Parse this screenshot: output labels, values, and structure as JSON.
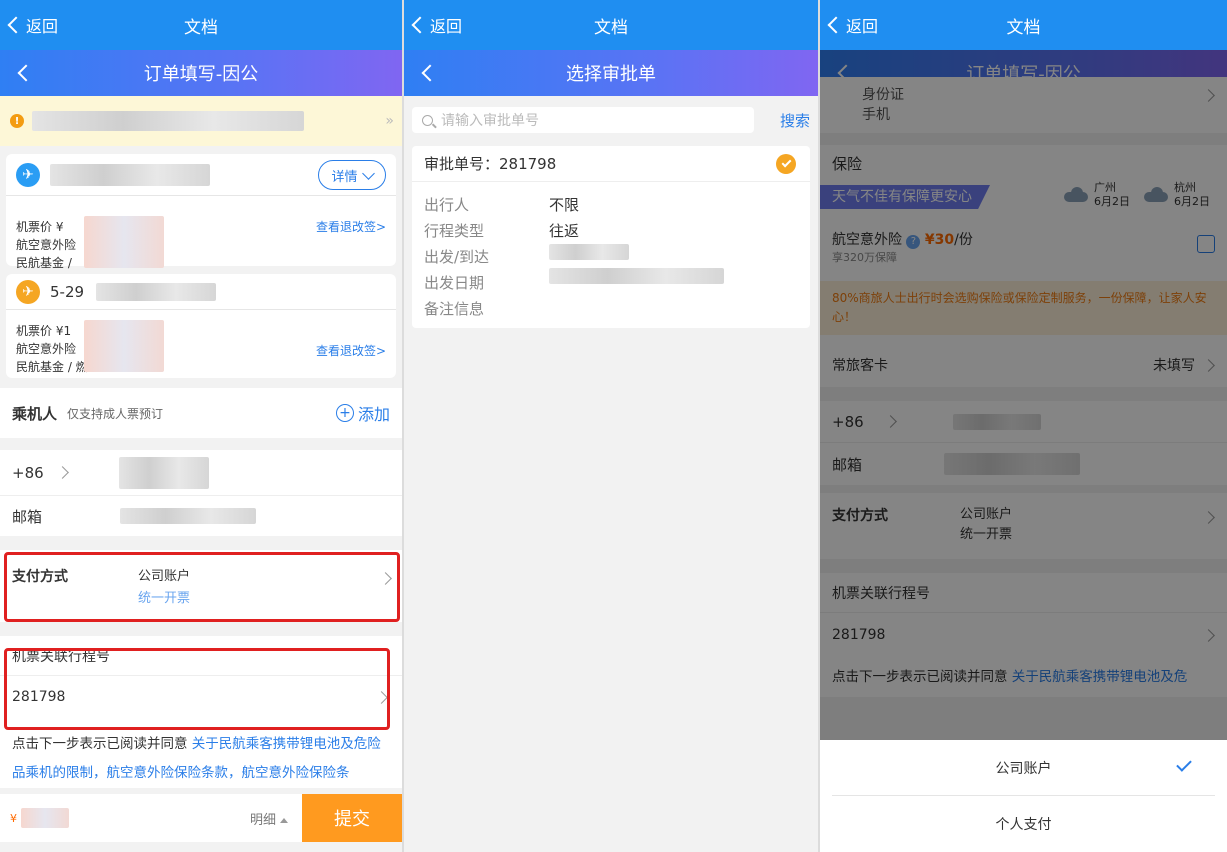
{
  "system": {
    "back_label": "返回",
    "title": "文档"
  },
  "panel1": {
    "nav_title": "订单填写-因公",
    "flight1": {
      "detail_label": "详情",
      "fee_labels": [
        "机票价 ¥",
        "航空意外险",
        "民航基金 /"
      ],
      "change_link": "查看退改签>"
    },
    "flight2": {
      "date": "5-29",
      "fee_labels": [
        "机票价 ¥1",
        "航空意外险",
        "民航基金 / 燃"
      ],
      "change_link": "查看退改签>"
    },
    "passenger": {
      "title": "乘机人",
      "note": "仅支持成人票预订",
      "add_label": "添加"
    },
    "phone_code": "+86",
    "email_label": "邮箱",
    "payment": {
      "label": "支付方式",
      "value": "公司账户",
      "sub": "统一开票"
    },
    "itinerary": {
      "label": "机票关联行程号",
      "value": "281798"
    },
    "agreement": {
      "prefix": "点击下一步表示已阅读并同意 ",
      "link": "关于民航乘客携带锂电池及危险品乘机的限制，航空意外险保险条款，航空意外险保险条"
    },
    "bottom": {
      "currency": "¥",
      "detail_label": "明细",
      "submit_label": "提交"
    }
  },
  "panel2": {
    "nav_title": "选择审批单",
    "search_placeholder": "请输入审批单号",
    "search_button": "搜索",
    "approval": {
      "number_label": "审批单号：281798",
      "rows": [
        {
          "key": "出行人",
          "value": "不限"
        },
        {
          "key": "行程类型",
          "value": "往返"
        },
        {
          "key": "出发/到达",
          "value": ""
        },
        {
          "key": "出发日期",
          "value": ""
        },
        {
          "key": "备注信息",
          "value": ""
        }
      ]
    }
  },
  "panel3": {
    "nav_title": "订单填写-因公",
    "top_partial": {
      "line1": "身份证",
      "line2": "手机"
    },
    "insurance": {
      "title": "保险",
      "banner": "天气不佳有保障更安心",
      "weather": [
        {
          "city": "广州",
          "date": "6月2日"
        },
        {
          "city": "杭州",
          "date": "6月2日"
        }
      ],
      "product": "航空意外险",
      "price": "¥30",
      "unit": "/份",
      "coverage": "享320万保障",
      "tip": "80%商旅人士出行时会选购保险或保险定制服务，一份保障，让家人安心！"
    },
    "frequent_flyer": {
      "label": "常旅客卡",
      "value": "未填写"
    },
    "phone_code": "+86",
    "email_label": "邮箱",
    "payment": {
      "label": "支付方式",
      "value": "公司账户",
      "sub": "统一开票"
    },
    "itinerary": {
      "label": "机票关联行程号",
      "value": "281798"
    },
    "agreement": {
      "prefix": "点击下一步表示已阅读并同意 ",
      "link": "关于民航乘客携带锂电池及危"
    },
    "sheet": {
      "options": [
        "公司账户",
        "个人支付"
      ],
      "selected_index": 0
    }
  },
  "colors": {
    "system_blue": "#1f8ef1",
    "accent_orange": "#ff9a1f",
    "link_blue": "#2a7ee8",
    "highlight_red": "#e02020"
  }
}
